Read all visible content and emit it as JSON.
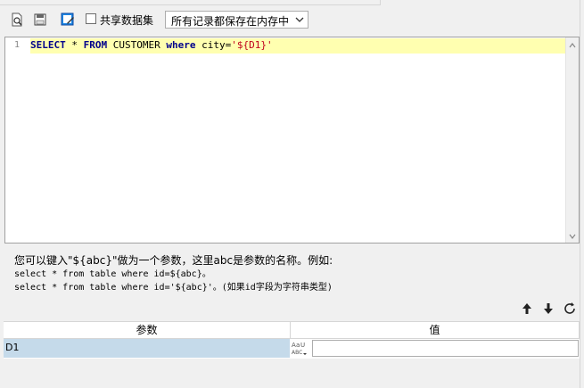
{
  "toolbar": {
    "share_dataset_label": "共享数据集",
    "share_dataset_checked": false,
    "storage_select_value": "所有记录都保存在内存中",
    "icons": [
      "preview-icon",
      "save-icon",
      "edit-icon"
    ]
  },
  "editor": {
    "line_number": "1",
    "code_tokens": {
      "select": "SELECT",
      "star": " * ",
      "from": "FROM",
      "table": " CUSTOMER ",
      "where": "where",
      "cond": " city=",
      "param": "'${D1}'"
    }
  },
  "hint": {
    "line1": "您可以键入\"${abc}\"做为一个参数，这里abc是参数的名称。例如:",
    "line2": "select * from table where id=${abc}。",
    "line3": "select * from table where id='${abc}'。(如果id字段为字符串类型)"
  },
  "params": {
    "columns": [
      "参数",
      "值"
    ],
    "rows": [
      {
        "name": "D1",
        "type_icon": "text-type-icon",
        "value": ""
      }
    ],
    "action_icons": [
      "move-up-icon",
      "move-down-icon",
      "refresh-icon"
    ]
  },
  "colors": {
    "keyword": "#00008b",
    "string": "#c0001c",
    "current_line": "#ffffb0",
    "selected_row": "#c5daea"
  }
}
